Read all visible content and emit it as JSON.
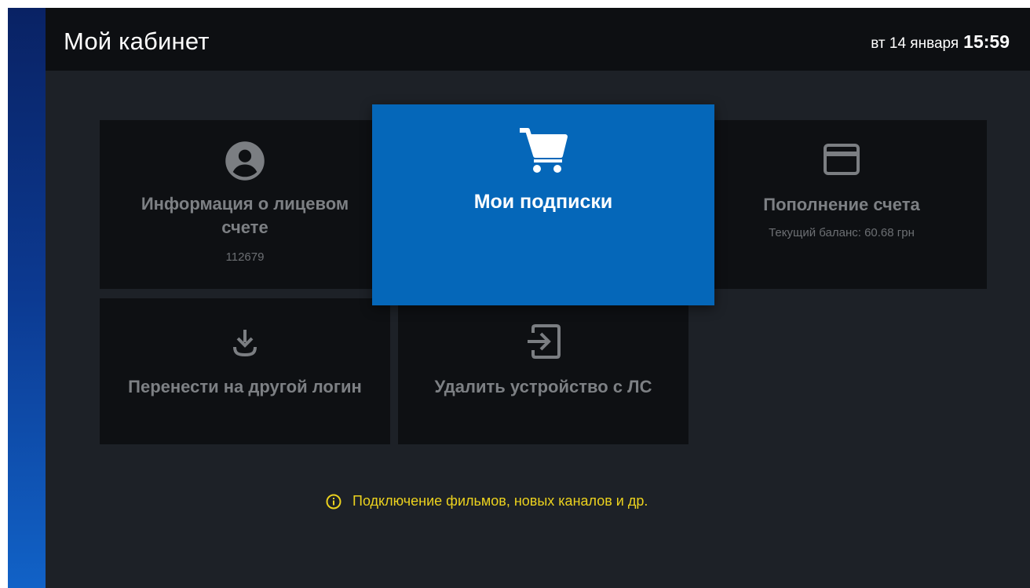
{
  "header": {
    "title": "Мой кабинет",
    "date": "вт 14 января",
    "time": "15:59"
  },
  "tiles": {
    "account": {
      "icon": "account-circle-icon",
      "title": "Информация о лицевом счете",
      "subtitle": "112679"
    },
    "subscriptions": {
      "icon": "cart-icon",
      "title": "Мои подписки"
    },
    "topup": {
      "icon": "credit-card-icon",
      "title": "Пополнение счета",
      "subtitle": "Текущий баланс: 60.68 грн"
    },
    "transfer": {
      "icon": "download-icon",
      "title": "Перенести на другой логин"
    },
    "remove": {
      "icon": "exit-icon",
      "title": "Удалить устройство с ЛС"
    }
  },
  "hint": {
    "icon": "info-icon",
    "text": "Подключение фильмов, новых каналов и др."
  },
  "colors": {
    "accent": "#0567b9",
    "background": "#1d2127",
    "tile": "#0e1013",
    "hint": "#ecd21e"
  }
}
